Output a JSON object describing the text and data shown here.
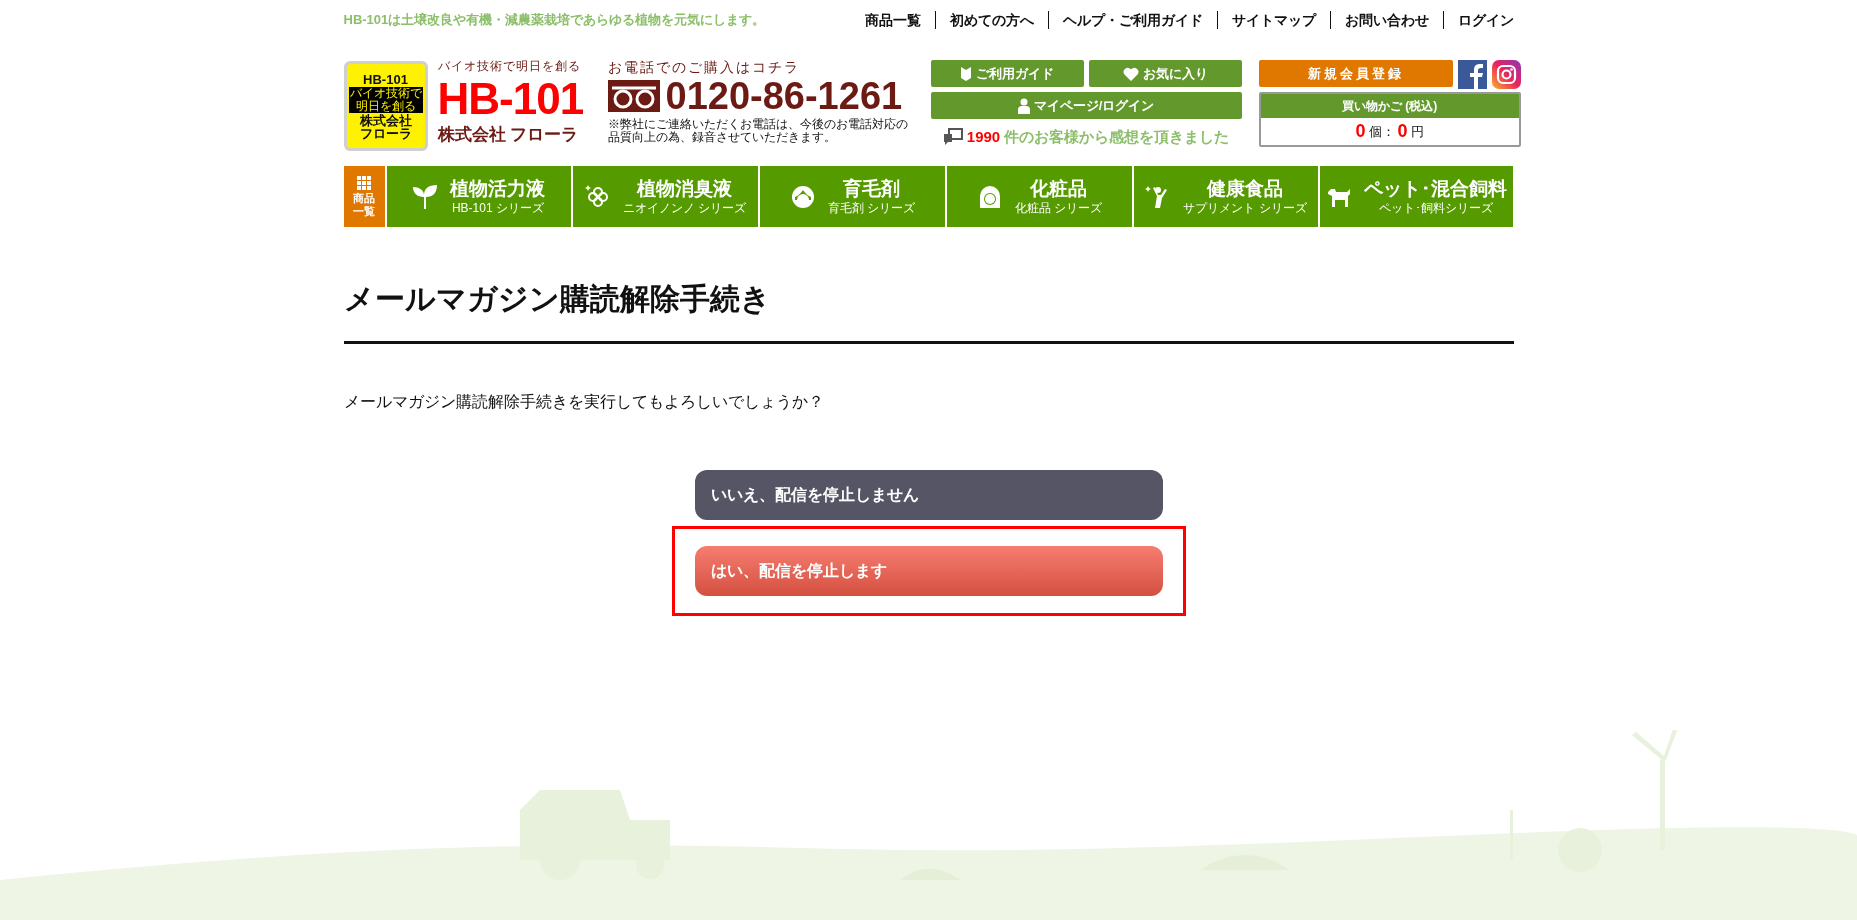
{
  "top_bar": {
    "tagline": "HB-101は土壌改良や有機・減農薬栽培であらゆる植物を元気にします。",
    "links": [
      "商品一覧",
      "初めての方へ",
      "ヘルプ・ご利用ガイド",
      "サイトマップ",
      "お問い合わせ",
      "ログイン"
    ]
  },
  "logo": {
    "badge_title": "HB-101",
    "badge_slogan": "バイオ技術で明日を創る",
    "badge_company": "株式会社",
    "badge_name": "フローラ",
    "slogan": "バイオ技術で明日を創る",
    "brand": "HB-101",
    "company": "株式会社 フローラ"
  },
  "phone": {
    "heading": "お電話でのご購入はコチラ",
    "number": "0120-86-1261",
    "note": "※弊社にご連絡いただくお電話は、今後のお電話対応の品質向上の為、録音させていただきます。"
  },
  "header_buttons": [
    {
      "label": "ご利用ガイド",
      "kind": "guide"
    },
    {
      "label": "お気に入り",
      "kind": "heart"
    },
    {
      "label": "マイページ/ログイン",
      "kind": "person"
    }
  ],
  "reviews": {
    "count": "1990",
    "text": "件のお客様から感想を頂きました"
  },
  "register": {
    "label": "新規会員登録"
  },
  "cart": {
    "title": "買い物かご (税込)",
    "count": "0",
    "count_unit": "個：",
    "total": "0",
    "total_unit": "円"
  },
  "nav": [
    {
      "kind": "grid",
      "lines": [
        "商品",
        "一覧"
      ]
    },
    {
      "kind": "leaf",
      "title": "植物活力液",
      "subtitle": "HB-101 シリーズ"
    },
    {
      "kind": "flower",
      "title": "植物消臭液",
      "subtitle": "ニオイノンノ シリーズ"
    },
    {
      "kind": "face",
      "title": "育毛剤",
      "subtitle": "育毛剤 シリーズ"
    },
    {
      "kind": "woman",
      "title": "化粧品",
      "subtitle": "化粧品 シリーズ"
    },
    {
      "kind": "person",
      "title": "健康食品",
      "subtitle": "サプリメント シリーズ"
    },
    {
      "kind": "dog",
      "title": "ペット･混合飼料",
      "subtitle": "ペット･飼料シリーズ"
    }
  ],
  "page": {
    "title": "メールマガジン購読解除手続き",
    "question": "メールマガジン購読解除手続きを実行してもよろしいでしょうか？"
  },
  "actions": [
    {
      "label": "いいえ、配信を停止しません",
      "kind": "cancel",
      "highlighted": false
    },
    {
      "label": "はい、配信を停止します",
      "kind": "confirm",
      "highlighted": true
    }
  ]
}
